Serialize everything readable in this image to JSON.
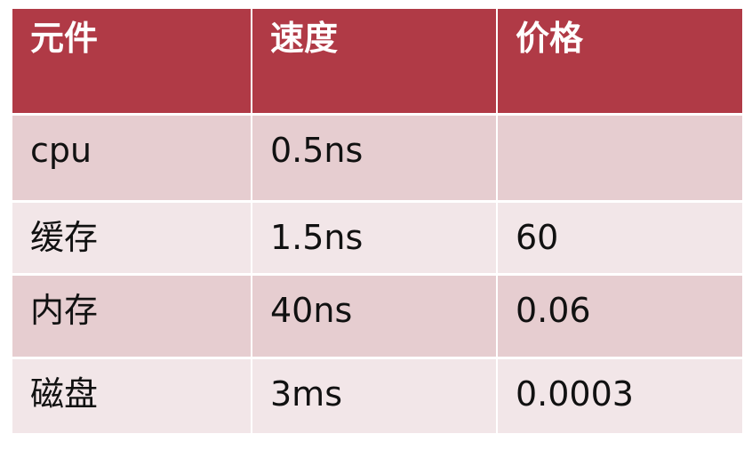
{
  "table": {
    "headers": [
      "元件",
      "速度",
      "价格"
    ],
    "rows": [
      [
        "cpu",
        "0.5ns",
        ""
      ],
      [
        "缓存",
        "1.5ns",
        "60"
      ],
      [
        "内存",
        "40ns",
        "0.06"
      ],
      [
        "磁盘",
        "3ms",
        "0.0003"
      ]
    ]
  },
  "colors": {
    "header_bg": "#b03a46",
    "row_odd_bg": "#e6cdd0",
    "row_even_bg": "#f2e6e8"
  }
}
